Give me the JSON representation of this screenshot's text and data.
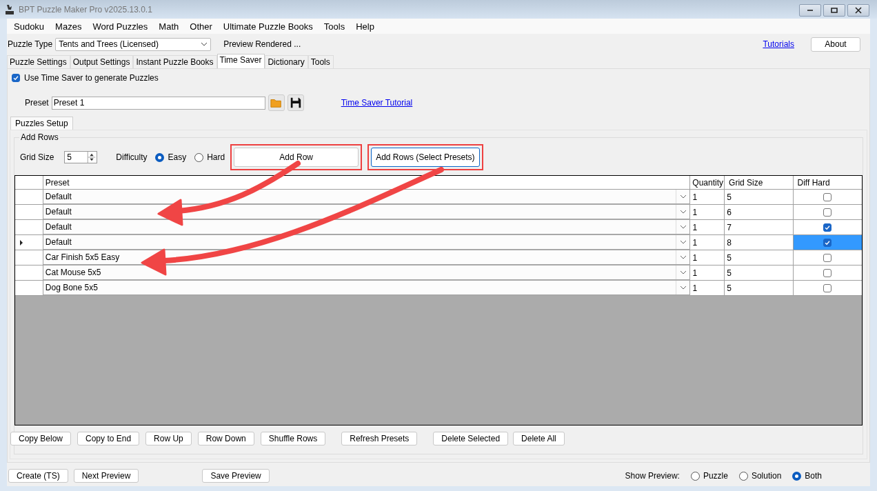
{
  "window": {
    "title": "BPT Puzzle Maker Pro v2025.13.0.1"
  },
  "menu": [
    "Sudoku",
    "Mazes",
    "Word Puzzles",
    "Math",
    "Other",
    "Ultimate Puzzle Books",
    "Tools",
    "Help"
  ],
  "puzzle_type": {
    "label": "Puzzle Type",
    "value": "Tents and Trees (Licensed)",
    "status": "Preview Rendered ..."
  },
  "tutorials_link": "Tutorials",
  "about_button": "About",
  "tabs": [
    {
      "label": "Puzzle Settings",
      "selected": false
    },
    {
      "label": "Output Settings",
      "selected": false
    },
    {
      "label": "Instant Puzzle Books",
      "selected": false
    },
    {
      "label": "Time Saver",
      "selected": true
    },
    {
      "label": "Dictionary",
      "selected": false
    },
    {
      "label": "Tools",
      "selected": false
    }
  ],
  "use_time_saver": {
    "label": "Use Time Saver to generate Puzzles",
    "checked": true
  },
  "preset": {
    "label": "Preset",
    "value": "Preset 1",
    "tutorial_link": "Time Saver Tutorial"
  },
  "inner_tabs": [
    {
      "label": "Puzzles Setup",
      "selected": true
    }
  ],
  "add_rows": {
    "title": "Add Rows",
    "grid_size_label": "Grid Size",
    "grid_size": "5",
    "difficulty_label": "Difficulty",
    "difficulty": [
      {
        "label": "Easy",
        "selected": true
      },
      {
        "label": "Hard",
        "selected": false
      }
    ],
    "buttons": [
      {
        "label": "Add Row",
        "highlighted": true,
        "focused": false
      },
      {
        "label": "Add Rows (Select Presets)",
        "highlighted": true,
        "focused": true
      }
    ]
  },
  "table": {
    "columns": [
      "Preset",
      "Quantity",
      "Grid Size",
      "Diff Hard"
    ],
    "rows": [
      {
        "preset": "Default",
        "quantity": "1",
        "grid_size": "5",
        "diff_hard": false,
        "current": false,
        "cell_selected": false
      },
      {
        "preset": "Default",
        "quantity": "1",
        "grid_size": "6",
        "diff_hard": false,
        "current": false,
        "cell_selected": false
      },
      {
        "preset": "Default",
        "quantity": "1",
        "grid_size": "7",
        "diff_hard": true,
        "current": false,
        "cell_selected": false
      },
      {
        "preset": "Default",
        "quantity": "1",
        "grid_size": "8",
        "diff_hard": true,
        "current": true,
        "cell_selected": true
      },
      {
        "preset": "Car Finish 5x5 Easy",
        "quantity": "1",
        "grid_size": "5",
        "diff_hard": false,
        "current": false,
        "cell_selected": false
      },
      {
        "preset": "Cat Mouse 5x5",
        "quantity": "1",
        "grid_size": "5",
        "diff_hard": false,
        "current": false,
        "cell_selected": false
      },
      {
        "preset": "Dog Bone 5x5",
        "quantity": "1",
        "grid_size": "5",
        "diff_hard": false,
        "current": false,
        "cell_selected": false
      }
    ]
  },
  "row_buttons": [
    "Copy Below",
    "Copy to End",
    "Row Up",
    "Row Down",
    "Shuffle Rows",
    "Refresh Presets",
    "Delete Selected",
    "Delete All"
  ],
  "bottom_buttons": [
    "Create (TS)",
    "Next Preview",
    "Save Preview"
  ],
  "show_preview": {
    "label": "Show Preview:",
    "options": [
      {
        "label": "Puzzle",
        "selected": false
      },
      {
        "label": "Solution",
        "selected": false
      },
      {
        "label": "Both",
        "selected": true
      }
    ]
  }
}
